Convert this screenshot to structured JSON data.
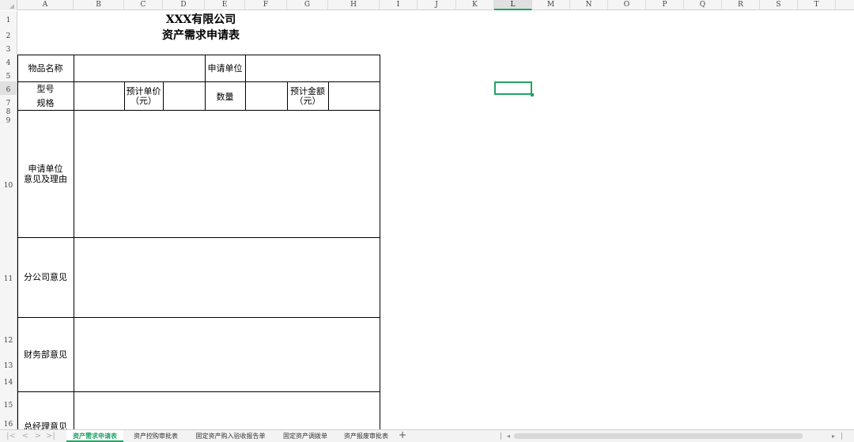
{
  "columns": [
    "A",
    "B",
    "C",
    "D",
    "E",
    "F",
    "G",
    "H",
    "I",
    "J",
    "K",
    "L",
    "M",
    "N",
    "O",
    "P",
    "Q",
    "R",
    "S",
    "T"
  ],
  "rows": [
    "1",
    "2",
    "3",
    "4",
    "5",
    "6",
    "7",
    "8",
    "9",
    "10",
    "11",
    "12",
    "13",
    "14",
    "15",
    "16"
  ],
  "selected_column": "L",
  "selected_row": "6",
  "form": {
    "company": "XXX有限公司",
    "title": "资产需求申请表",
    "item_name_label": "物品名称",
    "applicant_unit_label": "申请单位",
    "model_label_1": "型号",
    "model_label_2": "规格",
    "unit_price_label_1": "预计单价",
    "unit_price_label_2": "（元）",
    "quantity_label": "数量",
    "total_label_1": "预计金额",
    "total_label_2": "（元）",
    "opinion_label_1": "申请单位",
    "opinion_label_2": "意见及理由",
    "branch_opinion_label": "分公司意见",
    "finance_opinion_label": "财务部意见",
    "gm_opinion_label": "总经理意见"
  },
  "sheet_tabs": [
    "资产需求申请表",
    "资产控购审批表",
    "固定资产购入验收报告单",
    "固定资产调拨单",
    "资产报废审批表"
  ],
  "nav_icons": [
    "first-sheet-icon",
    "prev-sheet-icon",
    "next-sheet-icon",
    "last-sheet-icon"
  ],
  "nav_glyphs": [
    "|<",
    "<",
    ">",
    ">|"
  ],
  "add_tab_glyph": "+",
  "accent_color": "#21a366"
}
